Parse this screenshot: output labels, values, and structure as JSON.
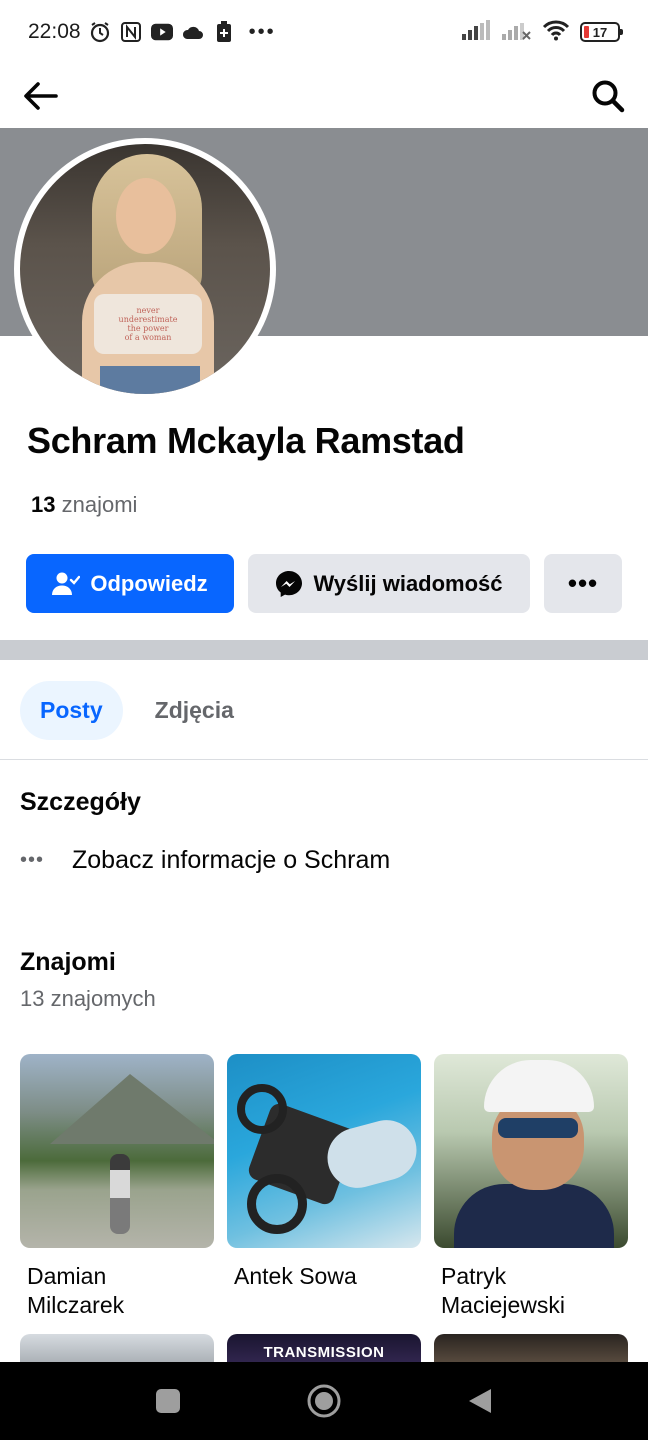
{
  "status_bar": {
    "time": "22:08",
    "dots": "•••",
    "battery": "17"
  },
  "app_bar": {
    "back_icon": "arrow-left-icon",
    "search_icon": "search-icon"
  },
  "profile": {
    "name": "Schram Mckayla Ramstad",
    "friends_number": "13",
    "friends_label": "znajomi",
    "shirt_text": [
      "never",
      "underestimate",
      "the power",
      "of a woman"
    ]
  },
  "actions": {
    "reply_label": "Odpowiedz",
    "message_label": "Wyślij wiadomość",
    "more_label": "•••"
  },
  "tabs": [
    {
      "label": "Posty",
      "active": true
    },
    {
      "label": "Zdjęcia",
      "active": false
    }
  ],
  "details": {
    "title": "Szczegóły",
    "dots": "•••",
    "info_text": "Zobacz informacje o Schram"
  },
  "friends": {
    "title": "Znajomi",
    "subtitle": "13 znajomych",
    "items": [
      {
        "name": "Damian Milczarek"
      },
      {
        "name": "Antek Sowa"
      },
      {
        "name": "Patryk Maciejewski"
      }
    ],
    "next_row_text": "TRANSMISSION"
  },
  "colors": {
    "primary": "#0866ff",
    "secondary_button": "#e4e6eb",
    "cover": "#8a8d91",
    "tab_active_bg": "#ebf5ff"
  }
}
